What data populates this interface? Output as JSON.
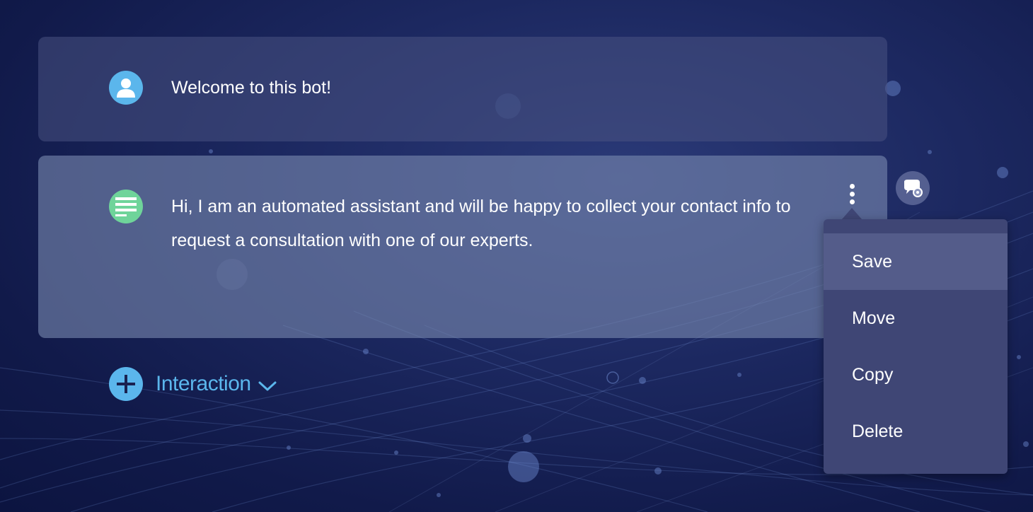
{
  "messages": [
    {
      "type": "user",
      "icon": "user-icon",
      "text": "Welcome to this bot!"
    },
    {
      "type": "text",
      "icon": "text-lines-icon",
      "text": "Hi, I am an automated assistant and will be happy to collect your contact info to request a consultation with one of our experts."
    }
  ],
  "actions": {
    "more_icon": "kebab-menu-icon",
    "settings_icon": "chat-settings-icon"
  },
  "context_menu": {
    "items": [
      {
        "label": "Save",
        "active": true
      },
      {
        "label": "Move",
        "active": false
      },
      {
        "label": "Copy",
        "active": false
      },
      {
        "label": "Delete",
        "active": false
      }
    ]
  },
  "add_interaction": {
    "label": "Interaction",
    "icon": "plus-icon",
    "dropdown_icon": "chevron-down-icon"
  },
  "colors": {
    "accent": "#5bb6ec",
    "text_icon_bg": "#6fd49a",
    "menu_bg": "#3f4675",
    "menu_active_bg": "#545c8a"
  }
}
